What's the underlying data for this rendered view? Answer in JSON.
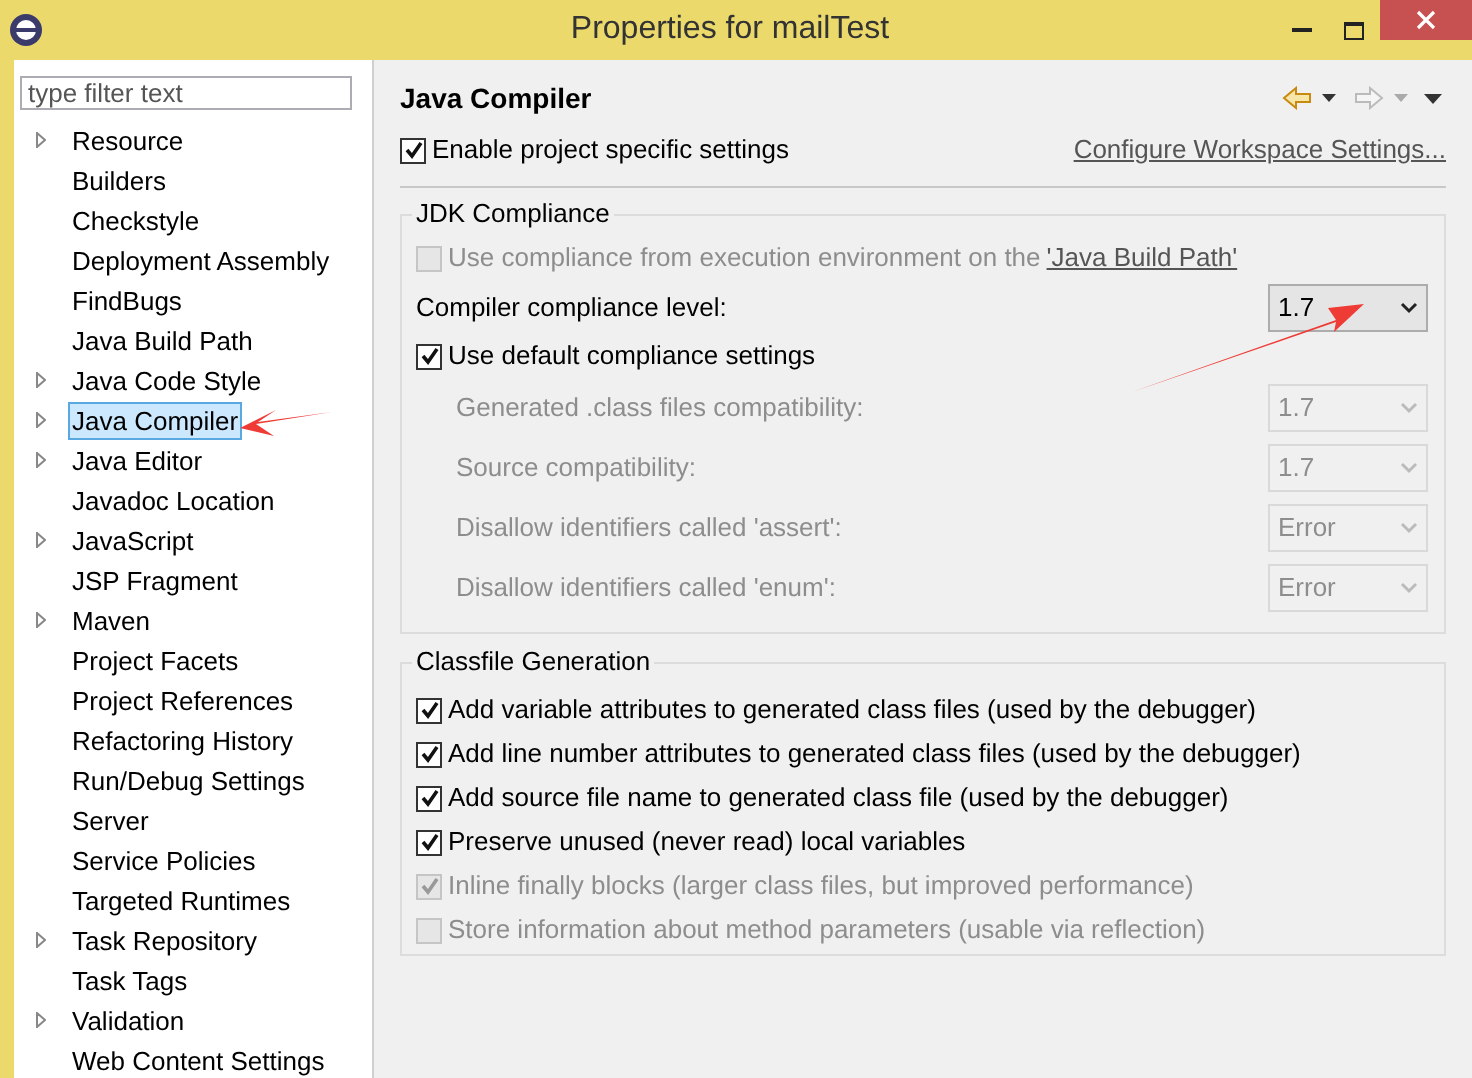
{
  "window": {
    "title": "Properties for mailTest"
  },
  "sidebar": {
    "filter": {
      "placeholder": "type filter text"
    },
    "items": [
      {
        "label": "Resource",
        "expandable": true,
        "selected": false
      },
      {
        "label": "Builders",
        "expandable": false,
        "selected": false
      },
      {
        "label": "Checkstyle",
        "expandable": false,
        "selected": false
      },
      {
        "label": "Deployment Assembly",
        "expandable": false,
        "selected": false
      },
      {
        "label": "FindBugs",
        "expandable": false,
        "selected": false
      },
      {
        "label": "Java Build Path",
        "expandable": false,
        "selected": false
      },
      {
        "label": "Java Code Style",
        "expandable": true,
        "selected": false
      },
      {
        "label": "Java Compiler",
        "expandable": true,
        "selected": true
      },
      {
        "label": "Java Editor",
        "expandable": true,
        "selected": false
      },
      {
        "label": "Javadoc Location",
        "expandable": false,
        "selected": false
      },
      {
        "label": "JavaScript",
        "expandable": true,
        "selected": false
      },
      {
        "label": "JSP Fragment",
        "expandable": false,
        "selected": false
      },
      {
        "label": "Maven",
        "expandable": true,
        "selected": false
      },
      {
        "label": "Project Facets",
        "expandable": false,
        "selected": false
      },
      {
        "label": "Project References",
        "expandable": false,
        "selected": false
      },
      {
        "label": "Refactoring History",
        "expandable": false,
        "selected": false
      },
      {
        "label": "Run/Debug Settings",
        "expandable": false,
        "selected": false
      },
      {
        "label": "Server",
        "expandable": false,
        "selected": false
      },
      {
        "label": "Service Policies",
        "expandable": false,
        "selected": false
      },
      {
        "label": "Targeted Runtimes",
        "expandable": false,
        "selected": false
      },
      {
        "label": "Task Repository",
        "expandable": true,
        "selected": false
      },
      {
        "label": "Task Tags",
        "expandable": false,
        "selected": false
      },
      {
        "label": "Validation",
        "expandable": true,
        "selected": false
      },
      {
        "label": "Web Content Settings",
        "expandable": false,
        "selected": false
      }
    ]
  },
  "page": {
    "title": "Java Compiler",
    "enable_project_settings": {
      "label": "Enable project specific settings",
      "checked": true
    },
    "configure_link": "Configure Workspace Settings...",
    "jdk_compliance": {
      "title": "JDK Compliance",
      "use_execution_environment": {
        "label": "Use compliance from execution environment on the ",
        "link": "'Java Build Path'",
        "checked": false,
        "disabled": true
      },
      "compliance_level": {
        "label": "Compiler compliance level:",
        "value": "1.7"
      },
      "use_default": {
        "label": "Use default compliance settings",
        "checked": true
      },
      "settings": [
        {
          "label": "Generated .class files compatibility:",
          "value": "1.7",
          "disabled": true
        },
        {
          "label": "Source compatibility:",
          "value": "1.7",
          "disabled": true
        },
        {
          "label": "Disallow identifiers called 'assert':",
          "value": "Error",
          "disabled": true
        },
        {
          "label": "Disallow identifiers called 'enum':",
          "value": "Error",
          "disabled": true
        }
      ]
    },
    "classfile_generation": {
      "title": "Classfile Generation",
      "options": [
        {
          "label": "Add variable attributes to generated class files (used by the debugger)",
          "checked": true,
          "disabled": false
        },
        {
          "label": "Add line number attributes to generated class files (used by the debugger)",
          "checked": true,
          "disabled": false
        },
        {
          "label": "Add source file name to generated class file (used by the debugger)",
          "checked": true,
          "disabled": false
        },
        {
          "label": "Preserve unused (never read) local variables",
          "checked": true,
          "disabled": false
        },
        {
          "label": "Inline finally blocks (larger class files, but improved performance)",
          "checked": true,
          "disabled": true
        },
        {
          "label": "Store information about method parameters (usable via reflection)",
          "checked": false,
          "disabled": true
        }
      ]
    }
  }
}
